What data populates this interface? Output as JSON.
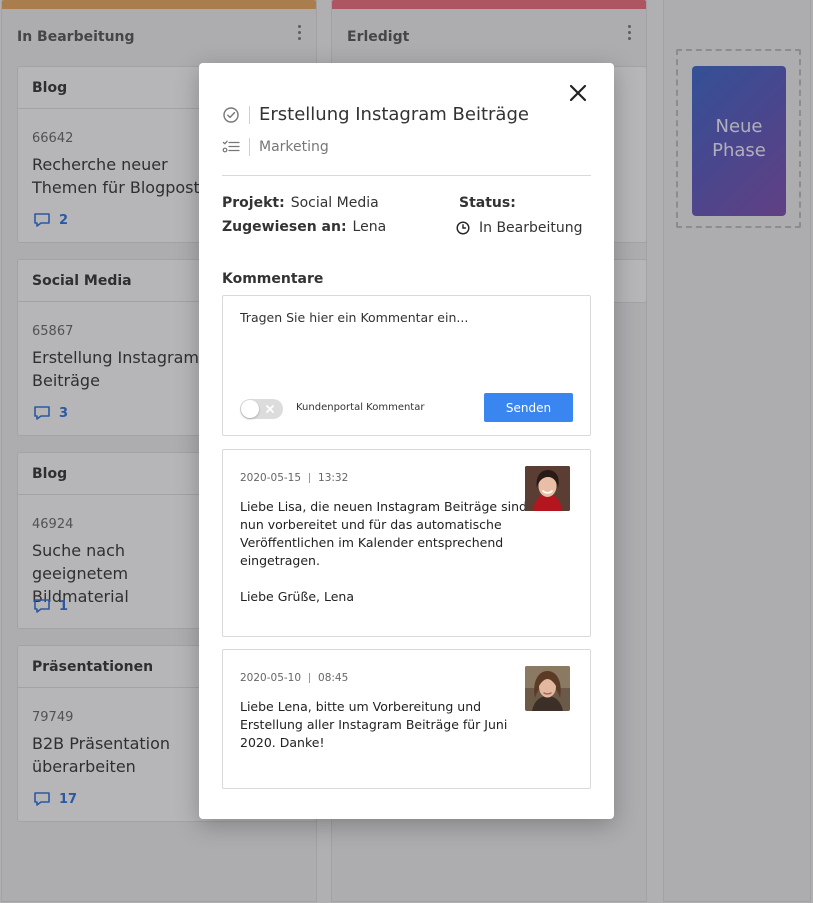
{
  "board": {
    "columns": [
      {
        "title": "In Bearbeitung",
        "accent": "#e7a65a"
      },
      {
        "title": "Erledigt",
        "accent": "#ec6a78"
      }
    ],
    "cards": [
      {
        "category": "Blog",
        "id": "66642",
        "title": "Recherche neuer Themen für Blogposts",
        "comments": "2"
      },
      {
        "category": "Social Media",
        "id": "65867",
        "title": "Erstellung Instagram Beiträge",
        "comments": "3"
      },
      {
        "category": "Blog",
        "id": "46924",
        "title": "Suche nach geeignetem Bildmaterial",
        "comments": "1"
      },
      {
        "category": "Präsentationen",
        "id": "79749",
        "title": "B2B Präsentation überarbeiten",
        "comments": "17"
      }
    ],
    "new_phase_label": "Neue Phase"
  },
  "modal": {
    "title": "Erstellung Instagram Beiträge",
    "category": "Marketing",
    "project_label": "Projekt:",
    "project_value": "Social Media",
    "assigned_label": "Zugewiesen an:",
    "assigned_value": "Lena",
    "status_label": "Status:",
    "status_value": "In Bearbeitung",
    "comments_heading": "Kommentare",
    "comment_placeholder": "Tragen Sie hier ein Kommentar ein...",
    "portal_toggle_label": "Kundenportal Kommentar",
    "send_label": "Senden",
    "accent": "#3a86f0"
  },
  "comments": [
    {
      "date": "2020-05-15",
      "time": "13:32",
      "text": "Liebe Lisa, die neuen Instagram Beiträge sind nun vorbereitet und für das automatische Veröffentlichen im Kalender entsprechend eingetragen.\n\nLiebe Grüße, Lena"
    },
    {
      "date": "2020-05-10",
      "time": "08:45",
      "text": "Liebe Lena, bitte um Vorbereitung und Erstellung aller Instagram Beiträge für Juni 2020. Danke!"
    }
  ]
}
